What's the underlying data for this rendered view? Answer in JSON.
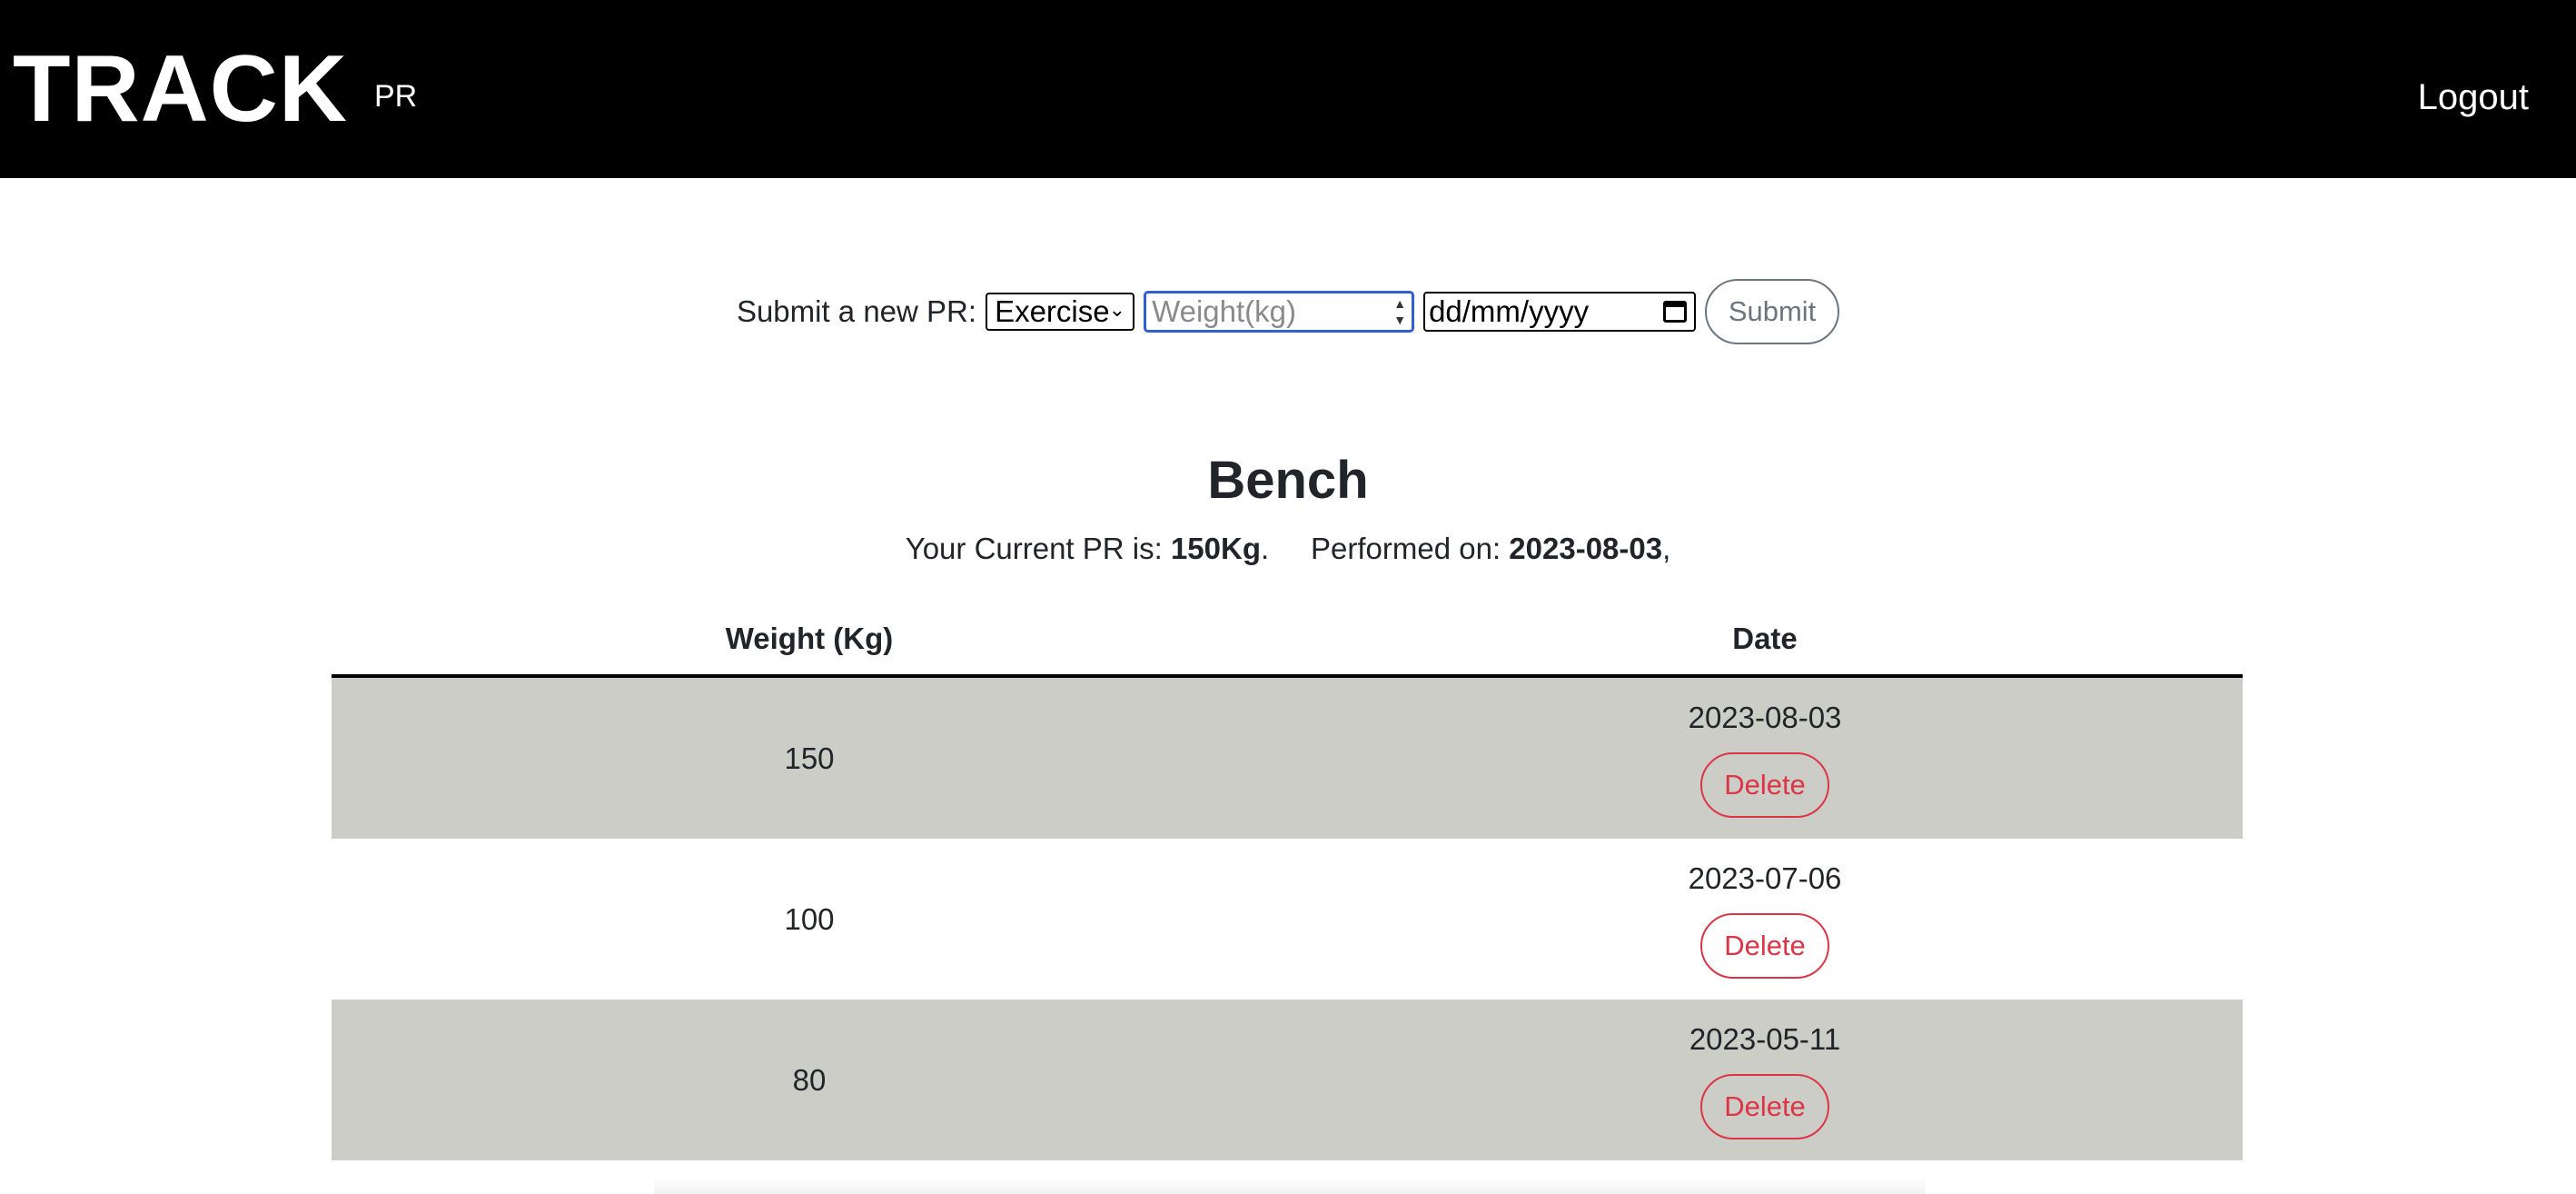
{
  "navbar": {
    "brand": "TRACK",
    "pr_link": "PR",
    "logout": "Logout"
  },
  "form": {
    "label": "Submit a new PR:",
    "exercise_selected": "Exercise",
    "weight_placeholder": "Weight(kg)",
    "date_placeholder": "dd/mm/yyyy",
    "submit_label": "Submit"
  },
  "exercise": {
    "title": "Bench",
    "pr_prefix": "Your Current PR is: ",
    "pr_value": "150Kg",
    "pr_sep": ".     Performed on: ",
    "pr_date": "2023-08-03",
    "pr_suffix": ","
  },
  "table": {
    "headers": [
      "Weight (Kg)",
      "Date"
    ],
    "rows": [
      {
        "weight": "150",
        "date": "2023-08-03",
        "action": "Delete"
      },
      {
        "weight": "100",
        "date": "2023-07-06",
        "action": "Delete"
      },
      {
        "weight": "80",
        "date": "2023-05-11",
        "action": "Delete"
      }
    ]
  },
  "colors": {
    "navbar_bg": "#000000",
    "row_shade": "#cccdc6",
    "delete_red": "#dc3545",
    "focus_blue": "#2f5fd0"
  }
}
